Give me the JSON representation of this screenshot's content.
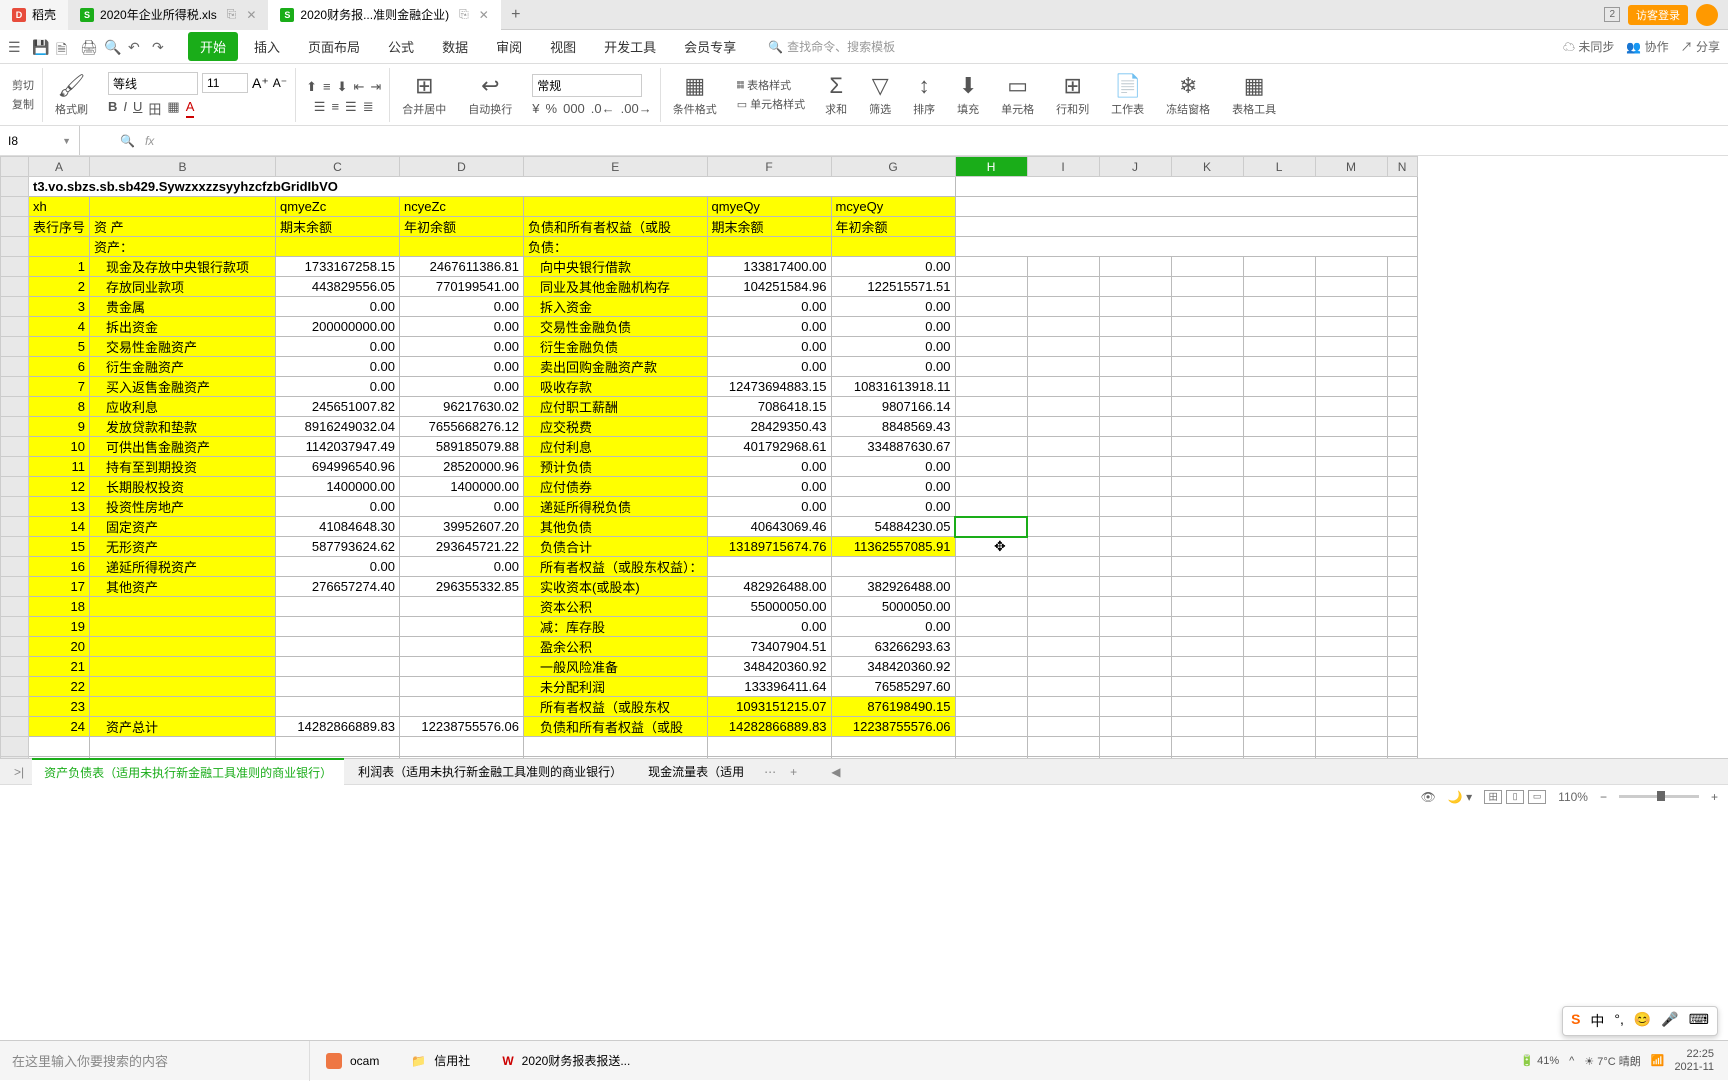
{
  "tabs": {
    "home": "稻壳",
    "t1": "2020年企业所得税.xls",
    "t2": "2020财务报...准则金融企业)",
    "count": "2",
    "login": "访客登录"
  },
  "menu": {
    "items": [
      "开始",
      "插入",
      "页面布局",
      "公式",
      "数据",
      "审阅",
      "视图",
      "开发工具",
      "会员专享"
    ],
    "search": "查找命令、搜索模板",
    "sync": "未同步",
    "coop": "协作",
    "share": "分享"
  },
  "toolbar": {
    "copy": "复制",
    "paint": "格式刷",
    "font": "等线",
    "size": "11",
    "numfmt": "常规",
    "merge": "合并居中",
    "wrap": "自动换行",
    "condfmt": "条件格式",
    "tblstyle": "表格样式",
    "cellstyle": "单元格样式",
    "sum": "求和",
    "filter": "筛选",
    "sort": "排序",
    "fill": "填充",
    "cell": "单元格",
    "rowcol": "行和列",
    "sheet": "工作表",
    "freeze": "冻结窗格",
    "tbltool": "表格工具"
  },
  "namebox": "I8",
  "cols": [
    "A",
    "B",
    "C",
    "D",
    "E",
    "F",
    "G",
    "H",
    "I",
    "J",
    "K",
    "L",
    "M",
    "N"
  ],
  "header_row": {
    "title": "t3.vo.sbzs.sb.sb429.SywzxxzzsyyhzcfzbGridIbVO",
    "xh": "xh",
    "qmyeZc": "qmyeZc",
    "ncyeZc": "ncyeZc",
    "qmyeQy": "qmyeQy",
    "mcyeQy": "mcyeQy",
    "rowno": "表行序号",
    "asset": "资 产",
    "qm": "期末余额",
    "nc": "年初余额",
    "liab": "负债和所有者权益（或股",
    "qm2": "期末余额",
    "nc2": "年初余额",
    "asset_sec": "资产：",
    "liab_sec": "负债："
  },
  "rows": [
    {
      "n": "1",
      "b": "现金及存放中央银行款项",
      "c": "1733167258.15",
      "d": "2467611386.81",
      "e": "向中央银行借款",
      "f": "133817400.00",
      "g": "0.00"
    },
    {
      "n": "2",
      "b": "存放同业款项",
      "c": "443829556.05",
      "d": "770199541.00",
      "e": "同业及其他金融机构存",
      "f": "104251584.96",
      "g": "122515571.51"
    },
    {
      "n": "3",
      "b": "贵金属",
      "c": "0.00",
      "d": "0.00",
      "e": "拆入资金",
      "f": "0.00",
      "g": "0.00"
    },
    {
      "n": "4",
      "b": "拆出资金",
      "c": "200000000.00",
      "d": "0.00",
      "e": "交易性金融负债",
      "f": "0.00",
      "g": "0.00"
    },
    {
      "n": "5",
      "b": "交易性金融资产",
      "c": "0.00",
      "d": "0.00",
      "e": "衍生金融负债",
      "f": "0.00",
      "g": "0.00"
    },
    {
      "n": "6",
      "b": "衍生金融资产",
      "c": "0.00",
      "d": "0.00",
      "e": "卖出回购金融资产款",
      "f": "0.00",
      "g": "0.00"
    },
    {
      "n": "7",
      "b": "买入返售金融资产",
      "c": "0.00",
      "d": "0.00",
      "e": "吸收存款",
      "f": "12473694883.15",
      "g": "10831613918.11"
    },
    {
      "n": "8",
      "b": "应收利息",
      "c": "245651007.82",
      "d": "96217630.02",
      "e": "应付职工薪酬",
      "f": "7086418.15",
      "g": "9807166.14"
    },
    {
      "n": "9",
      "b": "发放贷款和垫款",
      "c": "8916249032.04",
      "d": "7655668276.12",
      "e": "应交税费",
      "f": "28429350.43",
      "g": "8848569.43"
    },
    {
      "n": "10",
      "b": "可供出售金融资产",
      "c": "1142037947.49",
      "d": "589185079.88",
      "e": "应付利息",
      "f": "401792968.61",
      "g": "334887630.67"
    },
    {
      "n": "11",
      "b": "持有至到期投资",
      "c": "694996540.96",
      "d": "28520000.96",
      "e": "预计负债",
      "f": "0.00",
      "g": "0.00"
    },
    {
      "n": "12",
      "b": "长期股权投资",
      "c": "1400000.00",
      "d": "1400000.00",
      "e": "应付债券",
      "f": "0.00",
      "g": "0.00"
    },
    {
      "n": "13",
      "b": "投资性房地产",
      "c": "0.00",
      "d": "0.00",
      "e": "递延所得税负债",
      "f": "0.00",
      "g": "0.00"
    },
    {
      "n": "14",
      "b": "固定资产",
      "c": "41084648.30",
      "d": "39952607.20",
      "e": "其他负债",
      "f": "40643069.46",
      "g": "54884230.05"
    },
    {
      "n": "15",
      "b": "无形资产",
      "c": "587793624.62",
      "d": "293645721.22",
      "e": "负债合计",
      "f": "13189715674.76",
      "g": "11362557085.91"
    },
    {
      "n": "16",
      "b": "递延所得税资产",
      "c": "0.00",
      "d": "0.00",
      "e": "所有者权益（或股东权益）：",
      "f": "",
      "g": ""
    },
    {
      "n": "17",
      "b": "其他资产",
      "c": "276657274.40",
      "d": "296355332.85",
      "e": "实收资本(或股本)",
      "f": "482926488.00",
      "g": "382926488.00"
    },
    {
      "n": "18",
      "b": "",
      "c": "",
      "d": "",
      "e": "资本公积",
      "f": "55000050.00",
      "g": "5000050.00"
    },
    {
      "n": "19",
      "b": "",
      "c": "",
      "d": "",
      "e": "减：库存股",
      "f": "0.00",
      "g": "0.00"
    },
    {
      "n": "20",
      "b": "",
      "c": "",
      "d": "",
      "e": "盈余公积",
      "f": "73407904.51",
      "g": "63266293.63"
    },
    {
      "n": "21",
      "b": "",
      "c": "",
      "d": "",
      "e": "一般风险准备",
      "f": "348420360.92",
      "g": "348420360.92"
    },
    {
      "n": "22",
      "b": "",
      "c": "",
      "d": "",
      "e": "未分配利润",
      "f": "133396411.64",
      "g": "76585297.60"
    },
    {
      "n": "23",
      "b": "",
      "c": "",
      "d": "",
      "e": "所有者权益（或股东权",
      "f": "1093151215.07",
      "g": "876198490.15"
    },
    {
      "n": "24",
      "b": "资产总计",
      "c": "14282866889.83",
      "d": "12238755576.06",
      "e": "负债和所有者权益（或股",
      "f": "14282866889.83",
      "g": "12238755576.06"
    }
  ],
  "sheets": {
    "s1": "资产负债表（适用未执行新金融工具准则的商业银行）",
    "s2": "利润表（适用未执行新金融工具准则的商业银行）",
    "s3": "现金流量表（适用"
  },
  "status": {
    "zoom": "110%",
    "battery": "41%"
  },
  "taskbar": {
    "search": "在这里输入你要搜索的内容",
    "ocam": "ocam",
    "xys": "信用社",
    "wps": "2020财务报表报送...",
    "weather": "7°C 晴朗",
    "time": "22:25",
    "date": "2021-11"
  },
  "ime": {
    "chn": "中"
  }
}
